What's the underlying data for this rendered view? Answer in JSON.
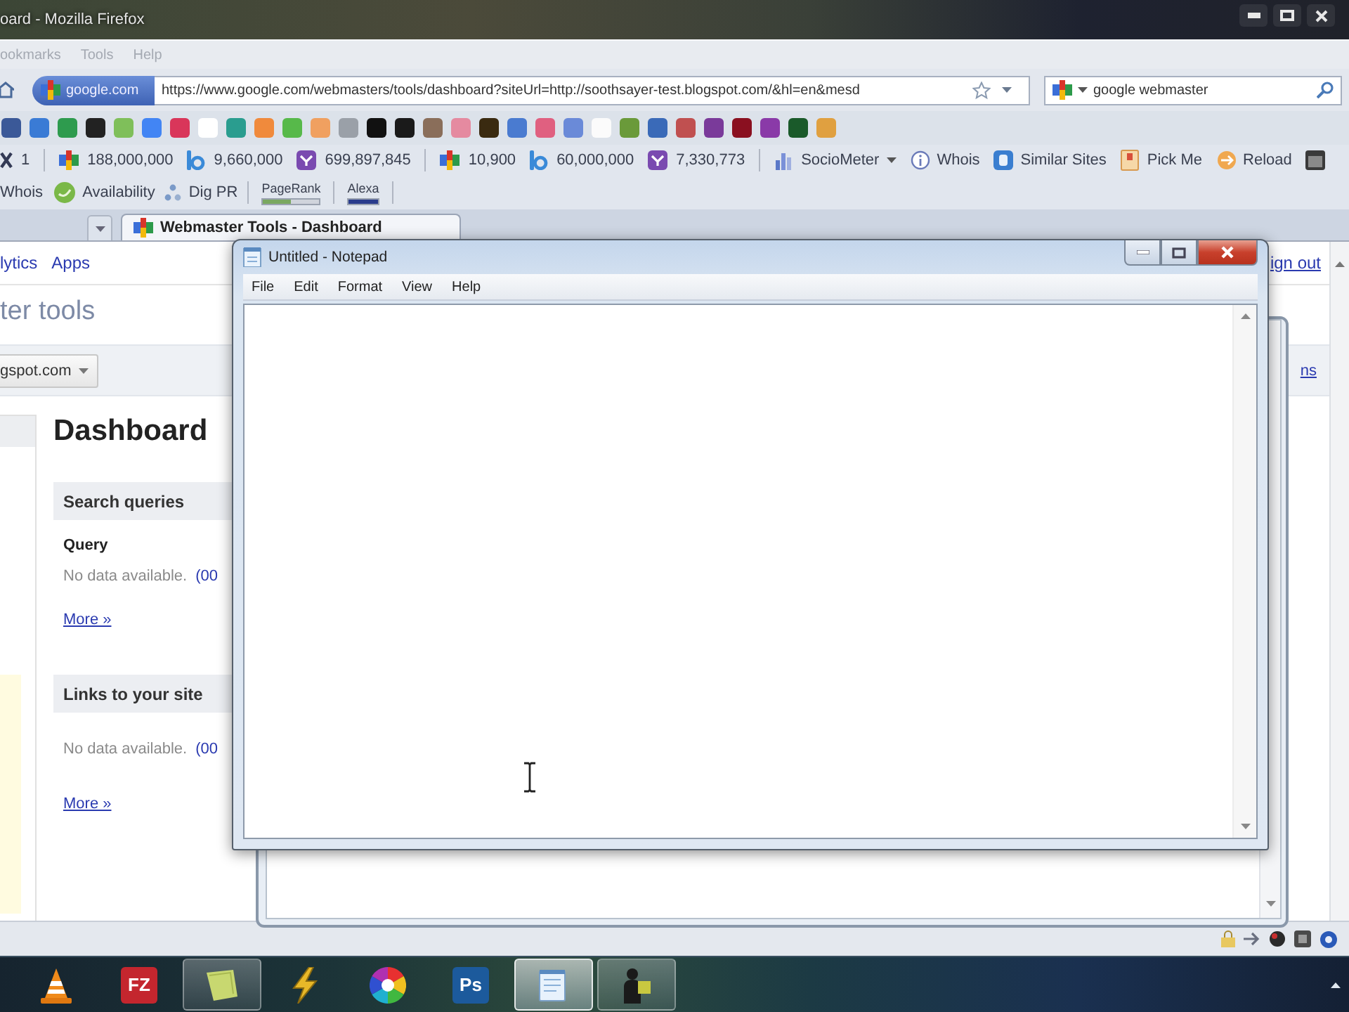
{
  "browser": {
    "title": "oard - Mozilla Firefox",
    "menu": [
      {
        "label": "ookmarks"
      },
      {
        "label": "Tools"
      },
      {
        "label": "Help"
      }
    ],
    "nav": {
      "identity": "google.com",
      "url": "https://www.google.com/webmasters/tools/dashboard?siteUrl=http://soothsayer-test.blogspot.com/&hl=en&mesd",
      "search": {
        "value": "google webmaster"
      }
    },
    "favicons": [
      {
        "color": "#3b5998"
      },
      {
        "color": "#3a7bd5"
      },
      {
        "color": "#2e9b4e"
      },
      {
        "color": "#222222"
      },
      {
        "color": "#7fbf5a"
      },
      {
        "color": "#4285f4"
      },
      {
        "color": "#d9365a"
      },
      {
        "color": "#ffffff"
      },
      {
        "color": "#2a9d8f"
      },
      {
        "color": "#f08a3c"
      },
      {
        "color": "#57b94a"
      },
      {
        "color": "#f0a060"
      },
      {
        "color": "#9aa0a8"
      },
      {
        "color": "#111111"
      },
      {
        "color": "#1a1a1a"
      },
      {
        "color": "#8a6e5a"
      },
      {
        "color": "#e58aa0"
      },
      {
        "color": "#3a2a10"
      },
      {
        "color": "#4a7bd0"
      },
      {
        "color": "#e06080"
      },
      {
        "color": "#6a8ad8"
      },
      {
        "color": "#fbfbfb"
      },
      {
        "color": "#6a9a3a"
      },
      {
        "color": "#3a6ab8"
      },
      {
        "color": "#c05050"
      },
      {
        "color": "#7a3a9a"
      },
      {
        "color": "#8a1020"
      },
      {
        "color": "#8a3aa8"
      },
      {
        "color": "#1a5a2a"
      },
      {
        "color": "#e0a040"
      }
    ],
    "stats": [
      {
        "kind": "x",
        "text": "1"
      },
      {
        "kind": "separator"
      },
      {
        "kind": "google",
        "text": "188,000,000"
      },
      {
        "kind": "bing",
        "text": "9,660,000"
      },
      {
        "kind": "yahoo",
        "text": "699,897,845"
      },
      {
        "kind": "separator"
      },
      {
        "kind": "google",
        "text": "10,900"
      },
      {
        "kind": "bing",
        "text": "60,000,000"
      },
      {
        "kind": "yahoo",
        "text": "7,330,773"
      },
      {
        "kind": "separator"
      },
      {
        "kind": "sociometer",
        "text": "SocioMeter"
      },
      {
        "kind": "info",
        "text": "Whois"
      },
      {
        "kind": "similar",
        "text": "Similar Sites"
      },
      {
        "kind": "pickme",
        "text": "Pick Me"
      },
      {
        "kind": "reload",
        "text": "Reload"
      },
      {
        "kind": "calendar"
      }
    ],
    "tools": [
      {
        "kind": "text",
        "text": "Whois"
      },
      {
        "kind": "availability",
        "text": "Availability"
      },
      {
        "kind": "digpr",
        "text": "Dig PR"
      },
      {
        "kind": "separator"
      },
      {
        "kind": "meter",
        "text": "PageRank",
        "level": 0.5,
        "color": "#7aa860"
      },
      {
        "kind": "separator"
      },
      {
        "kind": "meter",
        "text": "Alexa",
        "level": 1,
        "color": "#2a3c8c"
      },
      {
        "kind": "separator"
      }
    ],
    "tabs": [
      {
        "label": "Webmaster Tools - Dashboard",
        "selected": true
      }
    ],
    "page": {
      "top_links": [
        {
          "label": "lytics"
        },
        {
          "label": "Apps"
        }
      ],
      "account_link": "ign out",
      "product_title": "ter tools",
      "site_selector": "gspot.com",
      "side_link": "ns",
      "heading": "Dashboard",
      "sections": [
        {
          "title": "Search queries",
          "column": "Query",
          "message": "No data available.",
          "link": "(00",
          "more": "More »"
        },
        {
          "title": "Links to your site",
          "message": "No data available.",
          "link": "(00",
          "more": "More »"
        }
      ]
    }
  },
  "notepad": {
    "title": "Untitled - Notepad",
    "menu": [
      {
        "label": "File"
      },
      {
        "label": "Edit"
      },
      {
        "label": "Format"
      },
      {
        "label": "View"
      },
      {
        "label": "Help"
      }
    ]
  },
  "taskbar": {
    "apps": [
      {
        "kind": "cone",
        "running": false,
        "selected": false
      },
      {
        "kind": "lettertile",
        "label": "FZ",
        "color": "#c4262e",
        "running": false,
        "selected": false
      },
      {
        "kind": "note",
        "running": true,
        "selected": false
      },
      {
        "kind": "lightning",
        "running": false,
        "selected": false
      },
      {
        "kind": "wheel",
        "running": false,
        "selected": false
      },
      {
        "kind": "lettertile",
        "label": "Ps",
        "color": "#1c5a9c",
        "running": false,
        "selected": false
      },
      {
        "kind": "notepad",
        "running": true,
        "selected": true
      },
      {
        "kind": "figure",
        "running": true,
        "selected": false
      }
    ]
  }
}
